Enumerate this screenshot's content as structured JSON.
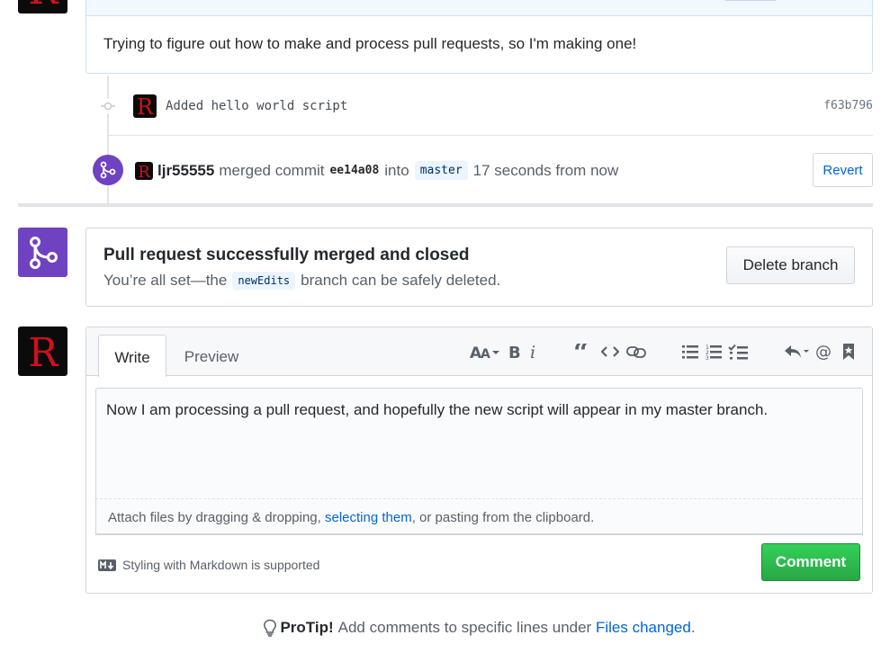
{
  "top_comment": {
    "body": "Trying to figure out how to make and process pull requests, so I'm making one!"
  },
  "commit": {
    "message": "Added hello world script",
    "sha": "f63b796"
  },
  "merge_event": {
    "author": "ljr55555",
    "action": "merged commit",
    "sha": "ee14a08",
    "into": "into",
    "branch": "master",
    "time": "17 seconds from now",
    "revert_label": "Revert"
  },
  "merged_box": {
    "title": "Pull request successfully merged and closed",
    "sub_prefix": "You’re all set—the",
    "branch": "newEdits",
    "sub_suffix": "branch can be safely deleted.",
    "delete_label": "Delete branch"
  },
  "comment_form": {
    "tabs": [
      {
        "label": "Write"
      },
      {
        "label": "Preview"
      }
    ],
    "text": "Now I am processing a pull request, and hopefully the new script will appear in my master branch.",
    "attach_prefix": "Attach files by dragging & dropping, ",
    "attach_link": "selecting them",
    "attach_suffix": ", or pasting from the clipboard.",
    "markdown_note": "Styling with Markdown is supported",
    "submit_label": "Comment",
    "toolbar_icons": [
      "text-size-icon",
      "bold-icon",
      "italic-icon",
      "quote-icon",
      "code-icon",
      "link-icon",
      "bullet-list-icon",
      "numbered-list-icon",
      "task-list-icon",
      "reply-icon",
      "mention-icon",
      "bookmark-icon"
    ]
  },
  "protip": {
    "label": "ProTip!",
    "text": "Add comments to specific lines under",
    "link": "Files changed",
    "end": "."
  },
  "colors": {
    "merged_purple": "#6f42c1",
    "comment_green": "#28a745",
    "link_blue": "#0366d6",
    "avatar_red": "#d0111b"
  }
}
